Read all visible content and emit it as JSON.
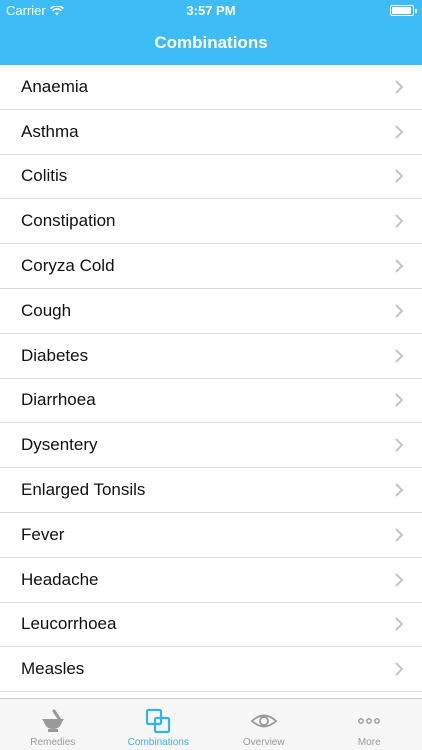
{
  "status_bar": {
    "carrier": "Carrier",
    "time": "3:57 PM"
  },
  "nav": {
    "title": "Combinations"
  },
  "list": {
    "items": [
      {
        "label": "Anaemia"
      },
      {
        "label": "Asthma"
      },
      {
        "label": "Colitis"
      },
      {
        "label": "Constipation"
      },
      {
        "label": "Coryza Cold"
      },
      {
        "label": "Cough"
      },
      {
        "label": "Diabetes"
      },
      {
        "label": "Diarrhoea"
      },
      {
        "label": "Dysentery"
      },
      {
        "label": "Enlarged Tonsils"
      },
      {
        "label": "Fever"
      },
      {
        "label": "Headache"
      },
      {
        "label": "Leucorrhoea"
      },
      {
        "label": "Measles"
      }
    ]
  },
  "tabs": [
    {
      "label": "Remedies",
      "icon": "mortar-pestle-icon"
    },
    {
      "label": "Combinations",
      "icon": "overlapping-squares-icon",
      "active": true
    },
    {
      "label": "Overview",
      "icon": "eye-icon"
    },
    {
      "label": "More",
      "icon": "more-dots-icon"
    }
  ],
  "colors": {
    "accent": "#3dbcf6",
    "tab_active": "#2fb4f0",
    "tab_inactive": "#9a9a9a"
  }
}
